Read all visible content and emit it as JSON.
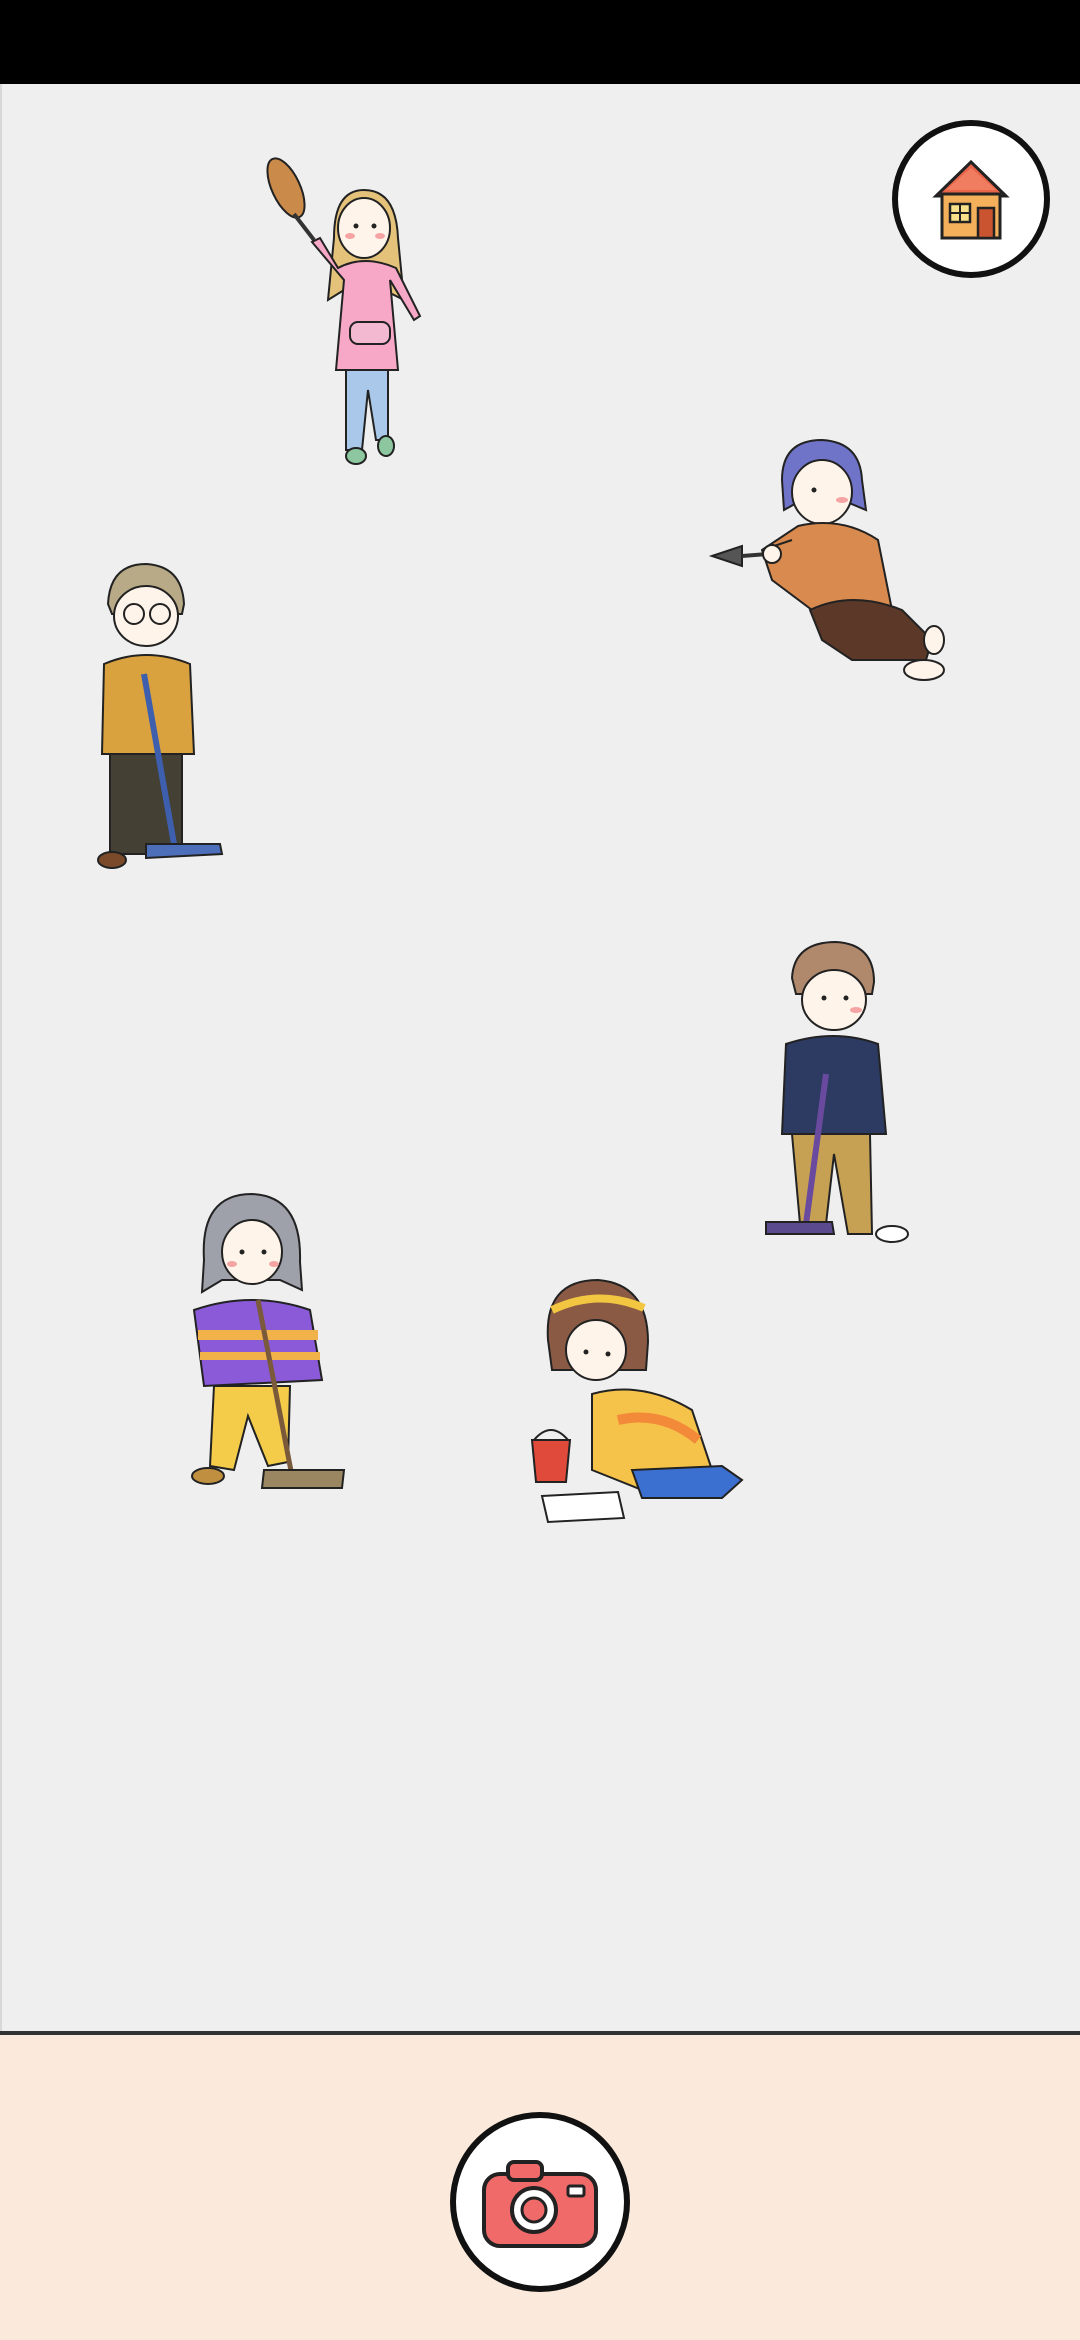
{
  "screen": {
    "background": "#efefef",
    "bottom_panel_color": "#fbeadb"
  },
  "icons": {
    "home": "house-icon",
    "camera": "camera-icon"
  },
  "characters": [
    {
      "id": "pink-hoodie-girl",
      "action": "dusting"
    },
    {
      "id": "plaid-shirt-boy",
      "action": "fanning"
    },
    {
      "id": "glasses-boy",
      "action": "vacuuming"
    },
    {
      "id": "navy-jacket-boy",
      "action": "vacuuming"
    },
    {
      "id": "purple-sweater-girl",
      "action": "sweeping"
    },
    {
      "id": "yellow-sweater-girl",
      "action": "wiping-floor"
    }
  ]
}
